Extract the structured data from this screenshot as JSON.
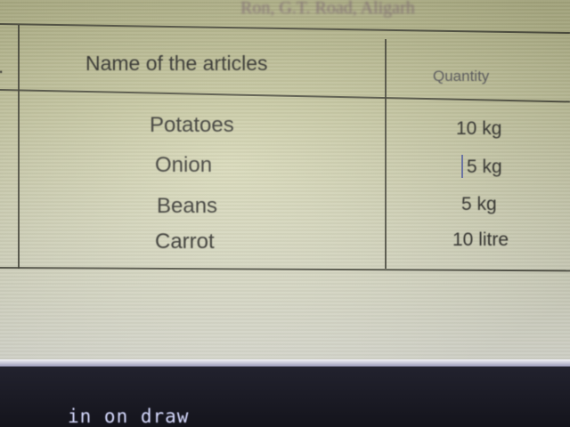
{
  "document": {
    "header_left": "",
    "header_right": "Ron, G.T. Road, Aligarh",
    "table": {
      "columns": [
        "Name of the articles",
        "Quantity"
      ],
      "rows": [
        {
          "name": "Potatoes",
          "quantity": "10 kg"
        },
        {
          "name": "Onion",
          "quantity": "5 kg"
        },
        {
          "name": "Beans",
          "quantity": "5 kg"
        },
        {
          "name": "Carrot",
          "quantity": "10 litre"
        }
      ]
    }
  },
  "terminal": {
    "line": "in on draw"
  }
}
